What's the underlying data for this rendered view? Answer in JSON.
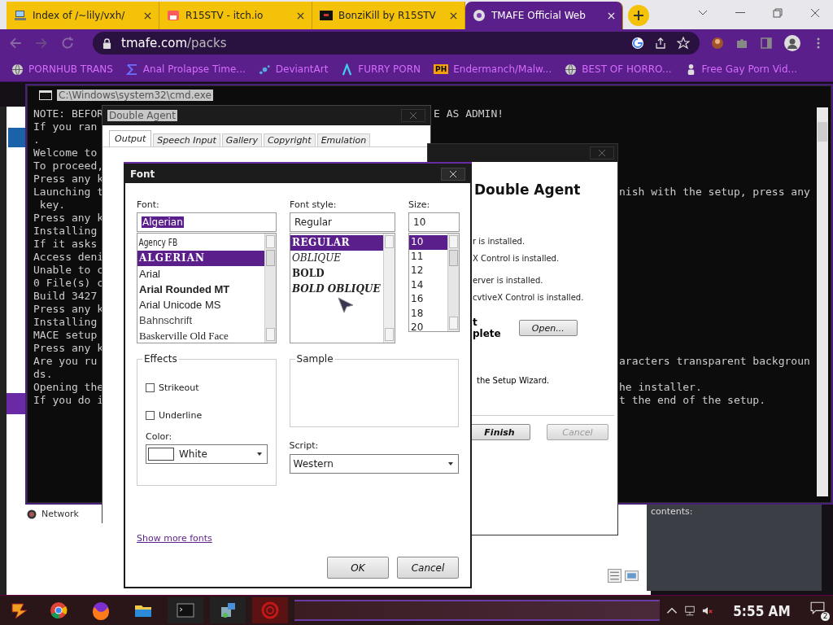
{
  "browser": {
    "tabs": [
      {
        "title": "Index of /~lily/vxh/",
        "selected": false,
        "kind": "computer"
      },
      {
        "title": "R15STV - itch.io",
        "selected": false,
        "kind": "store"
      },
      {
        "title": "BonziKill by R15STV",
        "selected": false,
        "kind": "dark"
      },
      {
        "title": "TMAFE Official Web",
        "selected": true,
        "kind": "disc"
      }
    ],
    "address": {
      "domain": "tmafe.com",
      "path": "/packs"
    },
    "bookmarks": [
      {
        "label": "PORNHUB TRANS",
        "kind": "globe"
      },
      {
        "label": "Anal Prolapse Time...",
        "kind": "sigma"
      },
      {
        "label": "DeviantArt",
        "kind": "dots"
      },
      {
        "label": "FURRY PORN",
        "kind": "lambda"
      },
      {
        "label": "Endermanch/Malw...",
        "kind": "badge",
        "badge": "PH"
      },
      {
        "label": "BEST OF HORRO...",
        "kind": "globe"
      },
      {
        "label": "Free Gay Porn Vid...",
        "kind": "figure"
      }
    ]
  },
  "back_window": {
    "nav_item": "Network",
    "pane_label": "contents:"
  },
  "cmd": {
    "title": "C:\\Windows\\system32\\cmd.exe",
    "lines": [
      {
        "text": "NOTE: BEFOR",
        "end": "E AS ADMIN!"
      },
      {
        "text": "If you ran"
      },
      {
        "text": "."
      },
      {
        "text": "Welcome to"
      },
      {
        "text": "To proceed,"
      },
      {
        "text": "Press any k"
      },
      {
        "text": "Launching t",
        "end": "nish with the setup, press any"
      },
      {
        "text": " key."
      },
      {
        "text": "Press any k"
      },
      {
        "text": "Installing"
      },
      {
        "text": "If it asks"
      },
      {
        "text": "Access deni"
      },
      {
        "text": "Unable to c"
      },
      {
        "text": "0 File(s) c"
      },
      {
        "text": "Build 3427"
      },
      {
        "text": "Press any k"
      },
      {
        "text": "Installing"
      },
      {
        "text": "MACE setup"
      },
      {
        "text": "Press any k"
      },
      {
        "text": "Are you ru",
        "end": "aracters transparent backgroun"
      },
      {
        "text": "ds."
      },
      {
        "text": "Opening the",
        "end": "he installer."
      },
      {
        "text": "If you do i",
        "end": "t the end of the setup."
      }
    ]
  },
  "agent_properties": {
    "title": "Double Agent",
    "tabs": [
      {
        "label": "Output",
        "selected": true
      },
      {
        "label": "Speech Input",
        "selected": false
      },
      {
        "label": "Gallery",
        "selected": false
      },
      {
        "label": "Copyright",
        "selected": false
      },
      {
        "label": "Emulation",
        "selected": false
      }
    ]
  },
  "installer": {
    "heading": "Double Agent",
    "status_lines": [
      "r is installed.",
      "X Control is installed.",
      "erver is installed.",
      "cvtiveX Control is installed."
    ],
    "complete_lines": [
      "t",
      "plete"
    ],
    "open_button": "Open...",
    "wizard_line": "the Setup Wizard.",
    "buttons": [
      {
        "label": "Finish",
        "disabled": false
      },
      {
        "label": "Cancel",
        "disabled": true
      }
    ]
  },
  "font_dialog": {
    "title": "Font",
    "font": {
      "label": "Font:",
      "value": "Algerian",
      "items": [
        {
          "label": "Agency FB",
          "kind": "narrow",
          "selected": false
        },
        {
          "label": "ALGERIAN",
          "kind": "display",
          "selected": true
        },
        {
          "label": "Arial",
          "kind": "plain",
          "selected": false
        },
        {
          "label": "Arial Rounded MT",
          "kind": "rounded",
          "selected": false
        },
        {
          "label": "Arial Unicode MS",
          "kind": "plain",
          "selected": false
        },
        {
          "label": "Bahnschrift",
          "kind": "light",
          "selected": false
        },
        {
          "label": "Baskerville Old Face",
          "kind": "serif",
          "selected": false
        }
      ]
    },
    "style": {
      "label": "Font style:",
      "value": "Regular",
      "items": [
        {
          "label": "REGULAR",
          "kind": "regular",
          "selected": true
        },
        {
          "label": "OBLIQUE",
          "kind": "oblique",
          "selected": false
        },
        {
          "label": "BOLD",
          "kind": "bold",
          "selected": false
        },
        {
          "label": "BOLD OBLIQUE",
          "kind": "bold-oblique",
          "selected": false
        }
      ]
    },
    "size": {
      "label": "Size:",
      "value": "10",
      "items": [
        {
          "label": "10",
          "selected": true
        },
        {
          "label": "11",
          "selected": false
        },
        {
          "label": "12",
          "selected": false
        },
        {
          "label": "14",
          "selected": false
        },
        {
          "label": "16",
          "selected": false
        },
        {
          "label": "18",
          "selected": false
        },
        {
          "label": "20",
          "selected": false
        }
      ]
    },
    "effects": {
      "label": "Effects",
      "options": [
        {
          "label": "Strikeout",
          "checked": false
        },
        {
          "label": "Underline",
          "checked": false
        }
      ],
      "color_label": "Color:",
      "color_name": "White"
    },
    "sample_label": "Sample",
    "script_label": "Script:",
    "script": "Western",
    "link": "Show more fonts",
    "buttons": [
      "OK",
      "Cancel"
    ]
  },
  "taskbar": {
    "time": "5:55 AM",
    "notifications": "2"
  }
}
